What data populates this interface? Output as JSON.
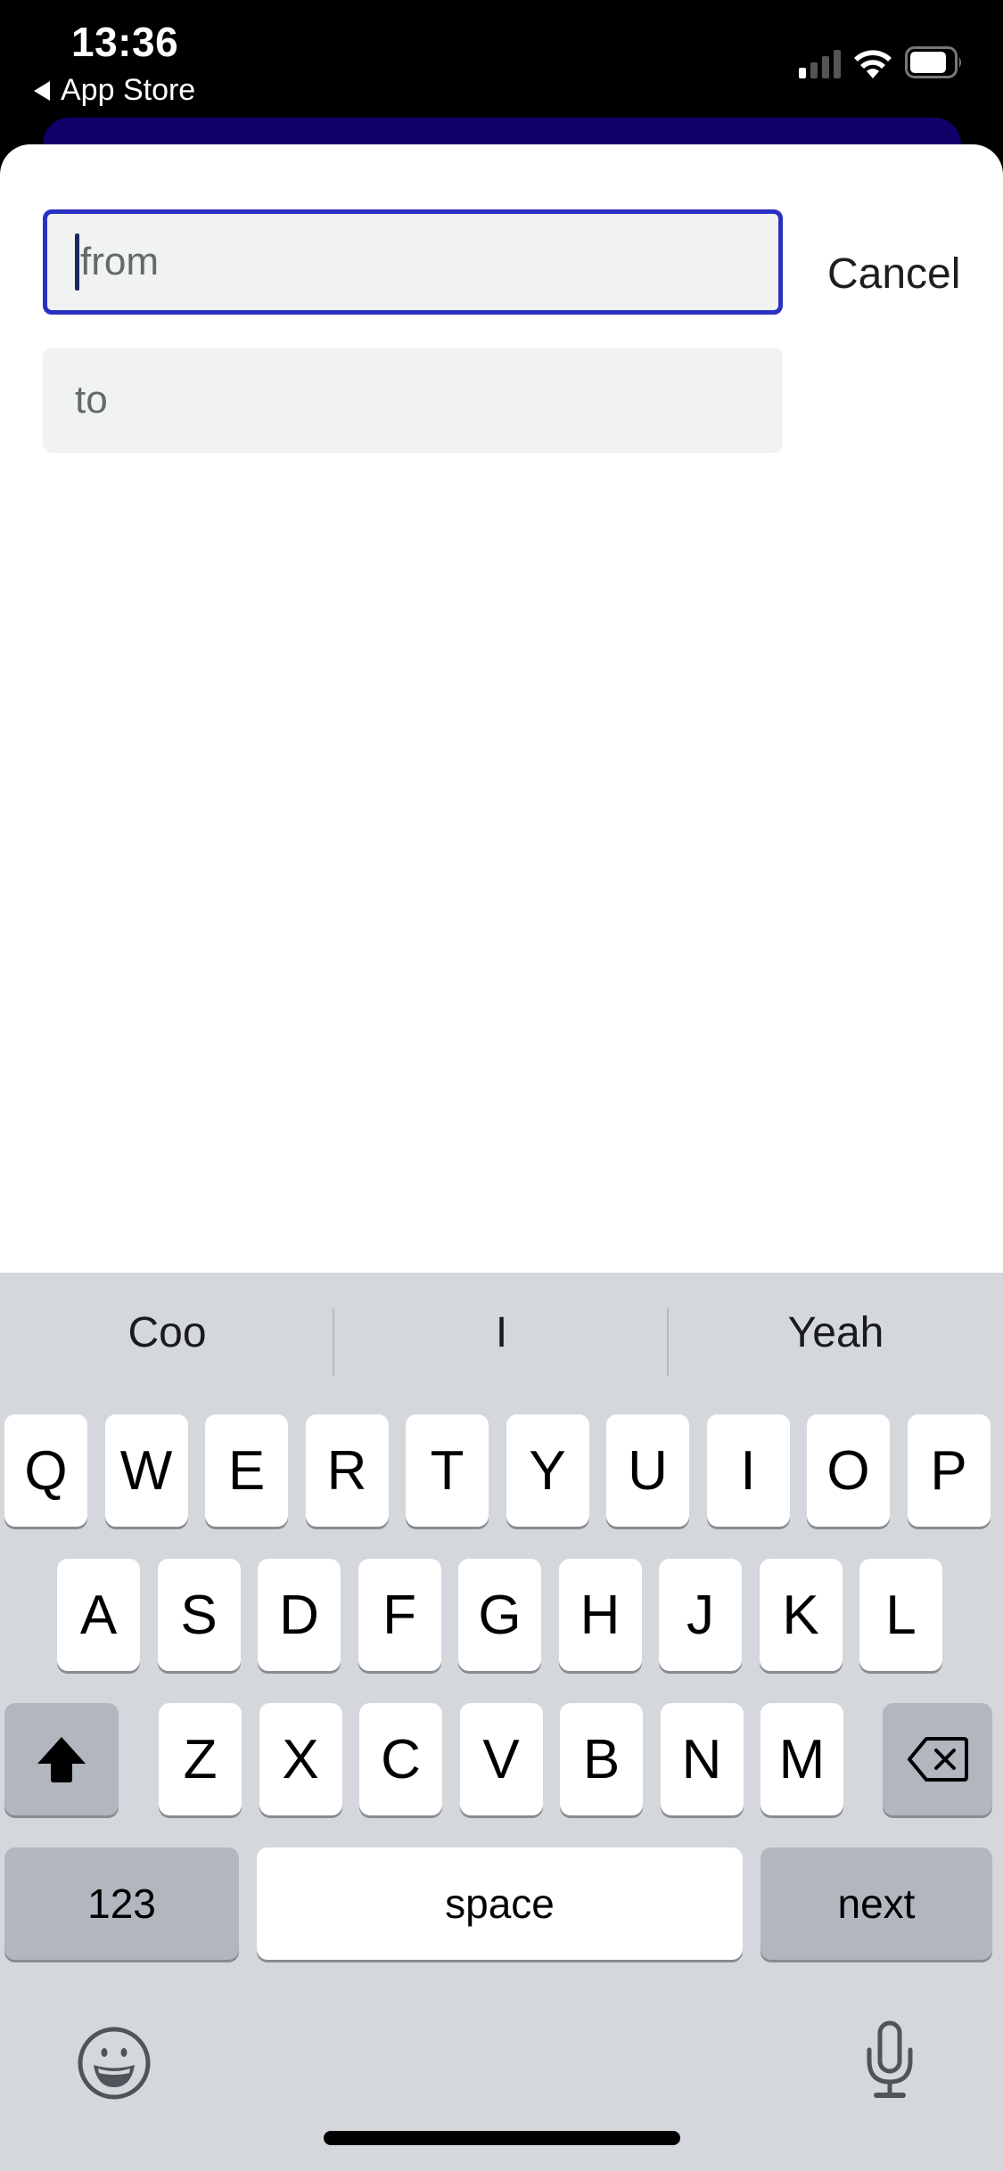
{
  "status_bar": {
    "time": "13:36",
    "back_label": "App Store",
    "icons": [
      "cellular-signal-icon",
      "wifi-icon",
      "battery-icon"
    ],
    "signal_bars_active": 1,
    "signal_bars_total": 4
  },
  "colors": {
    "focus_border": "#2a30c0",
    "card_behind": "#12006a",
    "field_bg": "#f1f2f2",
    "keyboard_bg": "#d4d7dc",
    "dark_key": "#b2b6be"
  },
  "search": {
    "from": {
      "value": "",
      "placeholder": "from",
      "focused": true
    },
    "to": {
      "value": "",
      "placeholder": "to",
      "focused": false
    },
    "cancel_label": "Cancel"
  },
  "keyboard": {
    "suggestions": [
      "Coo",
      "I",
      "Yeah"
    ],
    "row1": [
      "Q",
      "W",
      "E",
      "R",
      "T",
      "Y",
      "U",
      "I",
      "O",
      "P"
    ],
    "row2": [
      "A",
      "S",
      "D",
      "F",
      "G",
      "H",
      "J",
      "K",
      "L"
    ],
    "row3": [
      "Z",
      "X",
      "C",
      "V",
      "B",
      "N",
      "M"
    ],
    "numbers_label": "123",
    "space_label": "space",
    "return_label": "next",
    "shift_icon": "shift-icon",
    "delete_icon": "delete-icon",
    "emoji_icon": "emoji-icon",
    "mic_icon": "microphone-icon"
  }
}
